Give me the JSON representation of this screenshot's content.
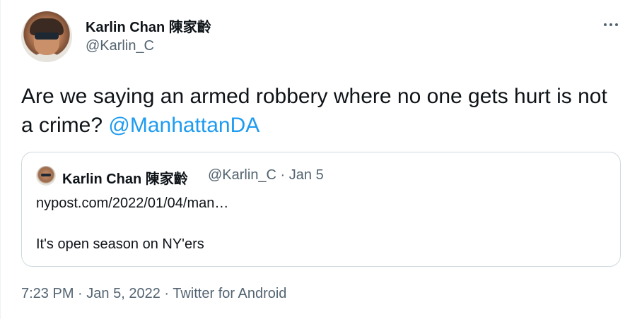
{
  "author": {
    "display_name": "Karlin Chan 陳家齡",
    "handle": "@Karlin_C"
  },
  "more_icon": "more-horizontal-icon",
  "tweet": {
    "text": "Are we saying an armed robbery where no one gets hurt is not a crime? ",
    "mention": "@ManhattanDA"
  },
  "quoted_tweet": {
    "display_name": "Karlin Chan 陳家齡",
    "meta": "@Karlin_C · Jan 5",
    "link_text": "nypost.com/2022/01/04/man…",
    "body_text": "It's open season on NY'ers"
  },
  "footer": {
    "time": "7:23 PM",
    "separator": "·",
    "date": "Jan 5, 2022",
    "source": "Twitter for Android"
  },
  "colors": {
    "accent": "#1d9bf0",
    "secondary_text": "#536471",
    "primary_text": "#0f1419",
    "border": "#cfd9de"
  }
}
